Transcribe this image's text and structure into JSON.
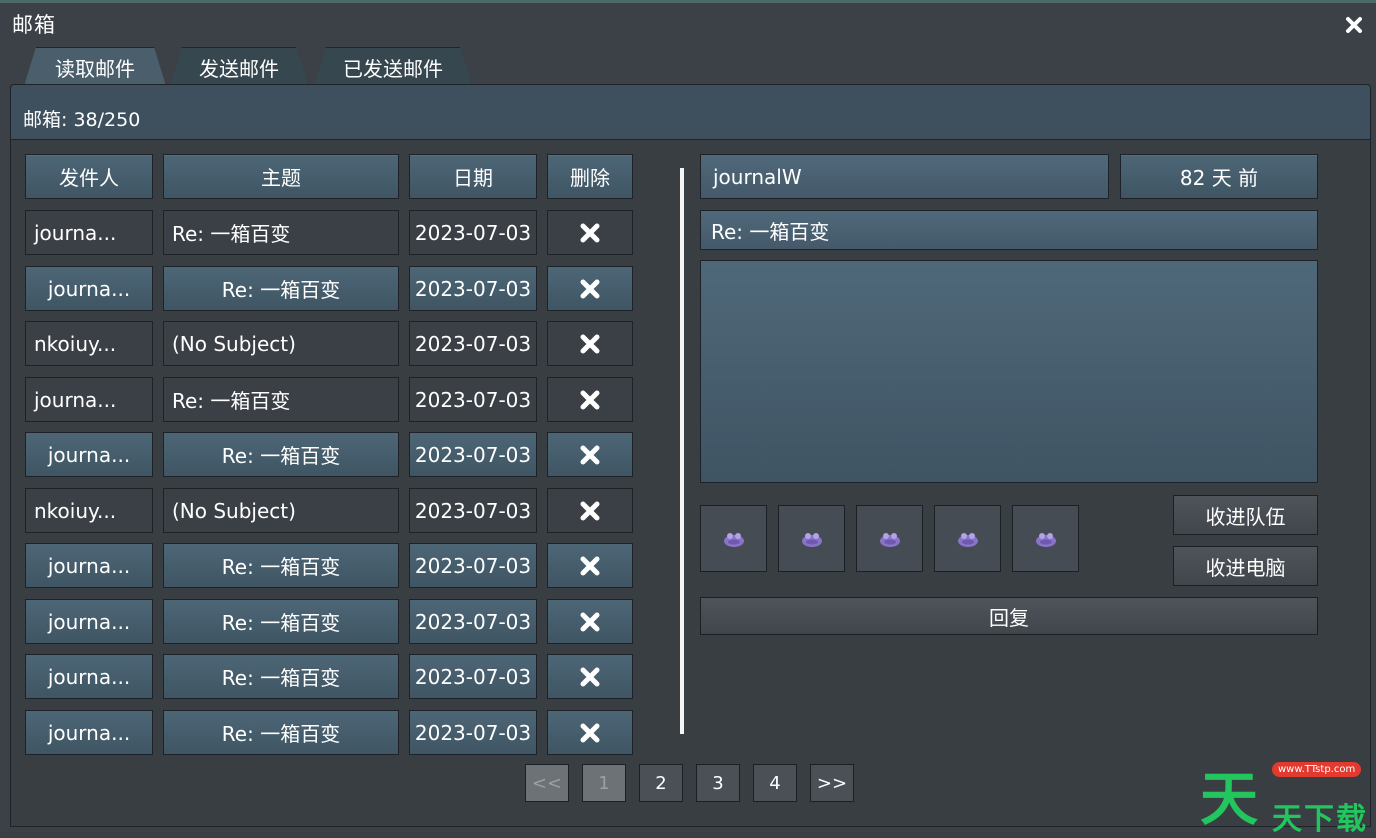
{
  "window": {
    "title": "邮箱"
  },
  "tabs": [
    "读取邮件",
    "发送邮件",
    "已发送邮件"
  ],
  "mailbox": {
    "count_label": "邮箱: 38/250"
  },
  "table": {
    "headers": {
      "sender": "发件人",
      "subject": "主题",
      "date": "日期",
      "delete": "删除"
    },
    "rows": [
      {
        "sender": "journa...",
        "subject": "Re: 一箱百变",
        "date": "2023-07-03",
        "style": "dark"
      },
      {
        "sender": "journa...",
        "subject": "Re: 一箱百变",
        "date": "2023-07-03",
        "style": "light"
      },
      {
        "sender": "nkoiuy...",
        "subject": "(No Subject)",
        "date": "2023-07-03",
        "style": "dark"
      },
      {
        "sender": "journa...",
        "subject": "Re: 一箱百变",
        "date": "2023-07-03",
        "style": "dark"
      },
      {
        "sender": "journa...",
        "subject": "Re: 一箱百变",
        "date": "2023-07-03",
        "style": "light"
      },
      {
        "sender": "nkoiuy...",
        "subject": "(No Subject)",
        "date": "2023-07-03",
        "style": "dark"
      },
      {
        "sender": "journa...",
        "subject": "Re: 一箱百变",
        "date": "2023-07-03",
        "style": "light"
      },
      {
        "sender": "journa...",
        "subject": "Re: 一箱百变",
        "date": "2023-07-03",
        "style": "light"
      },
      {
        "sender": "journa...",
        "subject": "Re: 一箱百变",
        "date": "2023-07-03",
        "style": "light"
      },
      {
        "sender": "journa...",
        "subject": "Re: 一箱百变",
        "date": "2023-07-03",
        "style": "light"
      }
    ]
  },
  "message": {
    "sender": "journalW",
    "age": "82 天 前",
    "subject": "Re: 一箱百变",
    "attachment_count": 5,
    "attachment_icon": "purple-blob-icon",
    "take_to_party": "收进队伍",
    "take_to_pc": "收进电脑",
    "reply": "回复"
  },
  "pagination": {
    "prev": "<<",
    "pages": [
      "1",
      "2",
      "3",
      "4"
    ],
    "current": "1",
    "next": ">>"
  },
  "watermark": {
    "main": "天",
    "sub": "天下载",
    "badge": "www.TTstp.com"
  },
  "colors": {
    "accent_row": "#4d6676",
    "dark_row": "#3b4046",
    "attachment": "#8a74c9",
    "watermark": "#22c55e"
  }
}
